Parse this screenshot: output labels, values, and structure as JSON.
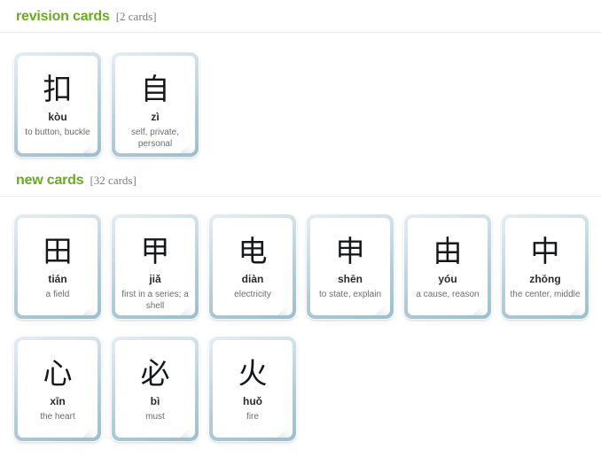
{
  "sections": [
    {
      "id": "revision",
      "title": "revision cards",
      "count_label": "[2 cards]",
      "rows": [
        [
          {
            "hanzi": "扣",
            "pinyin": "kòu",
            "meaning": "to button, buckle"
          },
          {
            "hanzi": "自",
            "pinyin": "zì",
            "meaning": "self, private, personal"
          }
        ]
      ]
    },
    {
      "id": "new",
      "title": "new cards",
      "count_label": "[32 cards]",
      "rows": [
        [
          {
            "hanzi": "田",
            "pinyin": "tián",
            "meaning": "a field"
          },
          {
            "hanzi": "甲",
            "pinyin": "jiǎ",
            "meaning": "first in a series; a shell"
          },
          {
            "hanzi": "电",
            "pinyin": "diàn",
            "meaning": "electricity"
          },
          {
            "hanzi": "申",
            "pinyin": "shēn",
            "meaning": "to state, explain"
          },
          {
            "hanzi": "由",
            "pinyin": "yóu",
            "meaning": "a cause, reason"
          },
          {
            "hanzi": "中",
            "pinyin": "zhōng",
            "meaning": "the center, middle"
          }
        ],
        [
          {
            "hanzi": "心",
            "pinyin": "xīn",
            "meaning": "the heart"
          },
          {
            "hanzi": "必",
            "pinyin": "bì",
            "meaning": "must"
          },
          {
            "hanzi": "火",
            "pinyin": "huǒ",
            "meaning": "fire"
          }
        ]
      ]
    }
  ],
  "colors": {
    "heading_green": "#6aab22",
    "count_grey": "#7d7d7d",
    "card_border_blue": "#b4ccd8",
    "rule_grey": "#ececec",
    "pinyin": "#2b2b2b",
    "meaning": "#6d6d6d"
  }
}
